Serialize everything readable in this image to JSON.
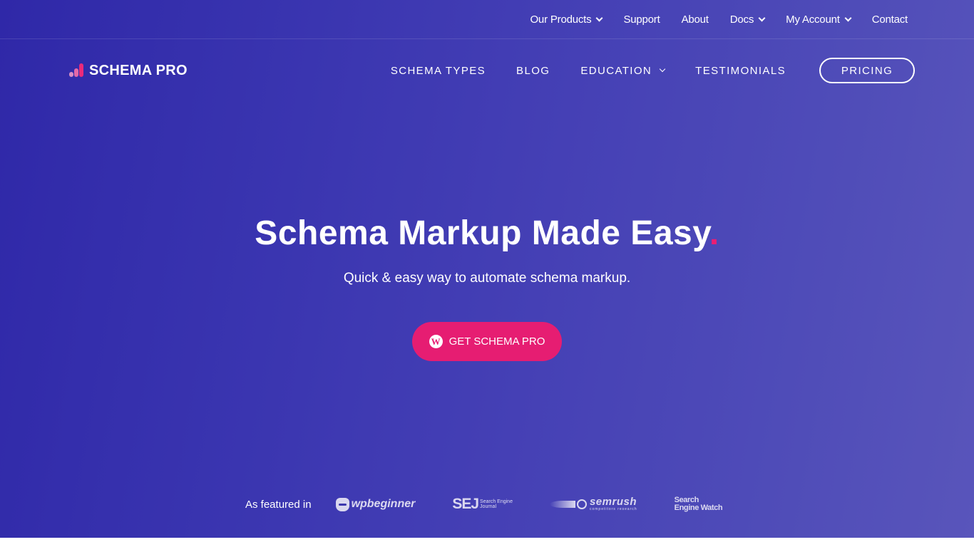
{
  "colors": {
    "gradient_start": "#2f28a8",
    "gradient_end": "#5955bb",
    "accent": "#e61d72",
    "text": "#ffffff"
  },
  "topbar": {
    "items": [
      {
        "label": "Our Products",
        "has_dropdown": true
      },
      {
        "label": "Support",
        "has_dropdown": false
      },
      {
        "label": "About",
        "has_dropdown": false
      },
      {
        "label": "Docs",
        "has_dropdown": true
      },
      {
        "label": "My Account",
        "has_dropdown": true
      },
      {
        "label": "Contact",
        "has_dropdown": false
      }
    ]
  },
  "header": {
    "logo_text": "SCHEMA PRO",
    "nav": [
      {
        "label": "SCHEMA TYPES",
        "has_dropdown": false
      },
      {
        "label": "BLOG",
        "has_dropdown": false
      },
      {
        "label": "EDUCATION",
        "has_dropdown": true
      },
      {
        "label": "TESTIMONIALS",
        "has_dropdown": false
      }
    ],
    "pricing_label": "PRICING"
  },
  "hero": {
    "headline": "Schema Markup Made Easy",
    "headline_dot": ".",
    "subheadline": "Quick & easy way to automate schema markup.",
    "cta_label": "GET SCHEMA PRO",
    "cta_icon": "wordpress-icon"
  },
  "featured": {
    "label": "As featured in",
    "logos": {
      "wpbeginner": "wpbeginner",
      "sej": "SEJ",
      "sej_sub_1": "Search Engine",
      "sej_sub_2": "Journal",
      "semrush": "semrush",
      "semrush_sub": "competitors research",
      "sew_1": "Search",
      "sew_2": "Engine Watch"
    }
  }
}
